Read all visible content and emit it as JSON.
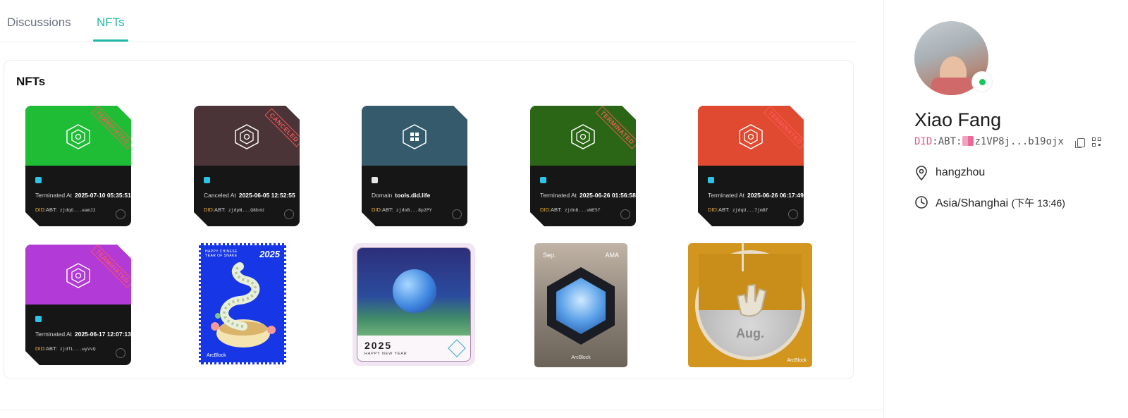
{
  "tabs": [
    {
      "label": "Discussions",
      "active": false
    },
    {
      "label": "NFTs",
      "active": true
    }
  ],
  "accent_color": "#1fb8a5",
  "panel": {
    "title": "NFTs"
  },
  "passports": [
    {
      "top_color": "#1fbd35",
      "stamp": "TERMINATED",
      "status_label": "Terminated At",
      "status_value": "2025-07-10 05:35:51",
      "did_prefix": "DID",
      "did_mid": ":ABT:",
      "did_short": "zjdqG...eamJ2",
      "icon": "hexagon-cube-icon"
    },
    {
      "top_color": "#4a3438",
      "stamp": "CANCELED",
      "status_label": "Canceled At",
      "status_value": "2025-06-05 12:52:55",
      "did_prefix": "DID",
      "did_mid": ":ABT:",
      "did_short": "zjdpN...Q8bnU",
      "icon": "hexagon-cube-icon"
    },
    {
      "top_color": "#345a6b",
      "stamp": "",
      "status_label": "Domain",
      "status_value": "tools.did.life",
      "did_prefix": "DID",
      "did_mid": ":ABT:",
      "did_short": "zjdoB...8p2PY",
      "icon": "hexagon-grid-icon"
    },
    {
      "top_color": "#2a6615",
      "stamp": "TERMINATED",
      "status_label": "Terminated At",
      "status_value": "2025-06-26 01:56:58",
      "did_prefix": "DID",
      "did_mid": ":ABT:",
      "did_short": "zjdn8...vWE5f",
      "icon": "hexagon-cube-icon"
    },
    {
      "top_color": "#e04a30",
      "stamp": "TERMINATED",
      "status_label": "Terminated At",
      "status_value": "2025-06-26 06:17:49",
      "did_prefix": "DID",
      "did_mid": ":ABT:",
      "did_short": "zjdqU...7jmBf",
      "icon": "hexagon-cube-icon"
    },
    {
      "top_color": "#b23ad6",
      "stamp": "TERMINATED",
      "status_label": "Terminated At",
      "status_value": "2025-06-17 12:07:13",
      "did_prefix": "DID",
      "did_mid": ":ABT:",
      "did_short": "zjdfL...wyVvQ",
      "icon": "hexagon-cube-icon"
    }
  ],
  "art": {
    "stamp": {
      "caption": "HAPPY CHINESE YEAR OF SNAKE",
      "year": "2025",
      "brand": "ArcBlock"
    },
    "earth": {
      "year": "2025",
      "caption": "HAPPY NEW YEAR"
    },
    "ama": {
      "month": "Sep.",
      "tag": "AMA",
      "brand": "ArcBlock"
    },
    "aug": {
      "label": "Aug.",
      "brand": "ArcBlock"
    }
  },
  "profile": {
    "name": "Xiao Fang",
    "did_prefix": "DID",
    "did_mid": ":ABT:",
    "did_short": "z1VP8j...b19ojx",
    "location": "hangzhou",
    "timezone": "Asia/Shanghai",
    "local_time": "(下午 13:46)",
    "online": true
  }
}
